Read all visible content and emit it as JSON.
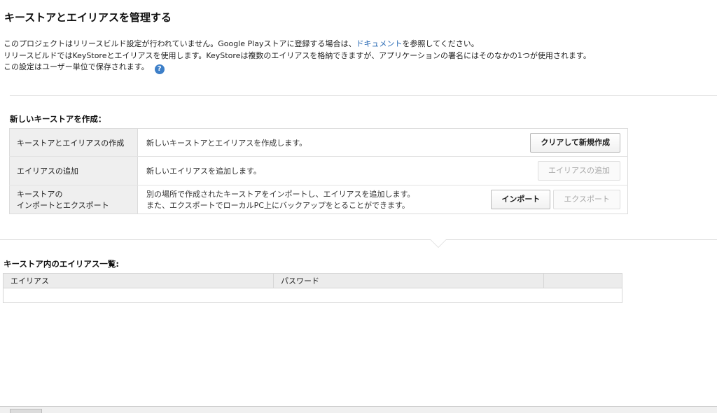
{
  "page": {
    "title": "キーストアとエイリアスを管理する"
  },
  "intro": {
    "line1_pre": "このプロジェクトはリリースビルド設定が行われていません。Google Playストアに登録する場合は、",
    "line1_link": "ドキュメント",
    "line1_post": "を参照してください。",
    "line2": "リリースビルドではKeyStoreとエイリアスを使用します。KeyStoreは複数のエイリアスを格納できますが、アプリケーションの署名にはそのなかの1つが使用されます。",
    "line3": "この設定はユーザー単位で保存されます。",
    "help_glyph": "?",
    "help_icon": "question-circle-icon"
  },
  "create_section": {
    "title": "新しいキーストアを作成：",
    "rows": [
      {
        "label": "キーストアとエイリアスの作成",
        "description": "新しいキーストアとエイリアスを作成します。",
        "button": "クリアして新規作成"
      },
      {
        "label": "エイリアスの追加",
        "description": "新しいエイリアスを追加します。",
        "button": "エイリアスの追加"
      },
      {
        "label_line1": "キーストアの",
        "label_line2": "インポートとエクスポート",
        "description_line1": "別の場所で作成されたキーストアをインポートし、エイリアスを追加します。",
        "description_line2": "また、エクスポートでローカルPC上にバックアップをとることができます。",
        "import_button": "インポート",
        "export_button": "エクスポート"
      }
    ]
  },
  "alias_section": {
    "title": "キーストア内のエイリアス一覧:",
    "columns": [
      "エイリアス",
      "パスワード",
      ""
    ]
  },
  "colors": {
    "link": "#2a6bb5",
    "help_icon": "#3d7fc8",
    "label_bg": "#efefef",
    "header_bg": "#ececec"
  }
}
